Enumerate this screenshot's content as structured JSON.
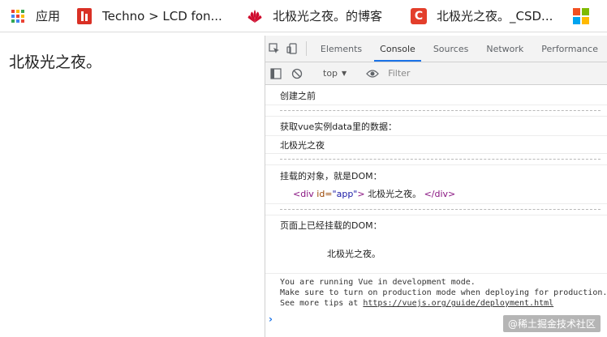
{
  "bookmarks": {
    "apps_label": "应用",
    "techno_label": "Techno > LCD fon...",
    "huawei_label": "北极光之夜。的博客",
    "csdn_label": "北极光之夜。_CSD...",
    "csdn_icon_letter": "C",
    "colors": {
      "techno": "#d93025",
      "csdn": "#e33e2b",
      "huawei": "#cf0a2c"
    }
  },
  "page": {
    "text": "北极光之夜。"
  },
  "devtools": {
    "tabs": [
      "Elements",
      "Console",
      "Sources",
      "Network",
      "Performance"
    ],
    "active_tab": "Console",
    "context": "top",
    "filter_placeholder": "Filter",
    "accent": "#1a73e8"
  },
  "console": {
    "line1": "创建之前",
    "divider": "----------------------------------------------------------------",
    "line2": "获取vue实例data里的数据：",
    "line3": "北极光之夜",
    "line4": "挂载的对象，就是DOM：",
    "el_open_tag": "<div",
    "el_attr": " id=",
    "el_attr_val": "\"app\"",
    "el_close_bracket": ">",
    "el_text": " 北极光之夜。 ",
    "el_end_tag": "</div>",
    "line5": "页面上已经挂载的DOM：",
    "line6": "北极光之夜。",
    "vue_line1": "You are running Vue in development mode.",
    "vue_line2": "Make sure to turn on production mode when deploying for production.",
    "vue_line3_prefix": "See more tips at ",
    "vue_line3_link": "https://vuejs.org/guide/deployment.html",
    "prompt": "›"
  },
  "watermark": "@稀土掘金技术社区"
}
